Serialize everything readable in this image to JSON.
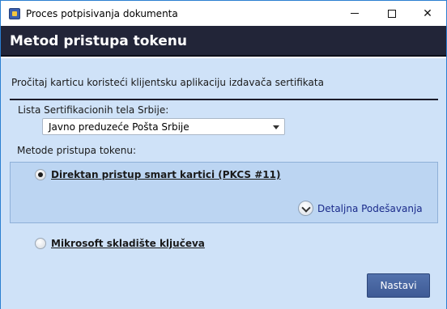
{
  "window": {
    "title": "Proces potpisivanja dokumenta"
  },
  "header": {
    "title": "Metod pristupa tokenu"
  },
  "content": {
    "instruction": "Pročitaj karticu koristeći klijentsku aplikaciju izdavača sertifikata",
    "cert_list_label": "Lista Sertifikacionih tela Srbije:",
    "cert_list_selected": "Javno preduzeće Pošta Srbije",
    "methods_label": "Metode pristupa tokenu:",
    "options": [
      {
        "label": "Direktan pristup smart kartici (PKCS #11)",
        "selected": true
      },
      {
        "label": "Mikrosoft skladište ključeva",
        "selected": false
      }
    ],
    "details_label": "Detaljna Podešavanja"
  },
  "footer": {
    "next_label": "Nastavi"
  },
  "colors": {
    "header_bg": "#222538",
    "body_bg": "#cfe2f8",
    "panel_bg": "#bcd5f2",
    "button_bg": "#4a66a0",
    "link": "#1a2a8a"
  }
}
